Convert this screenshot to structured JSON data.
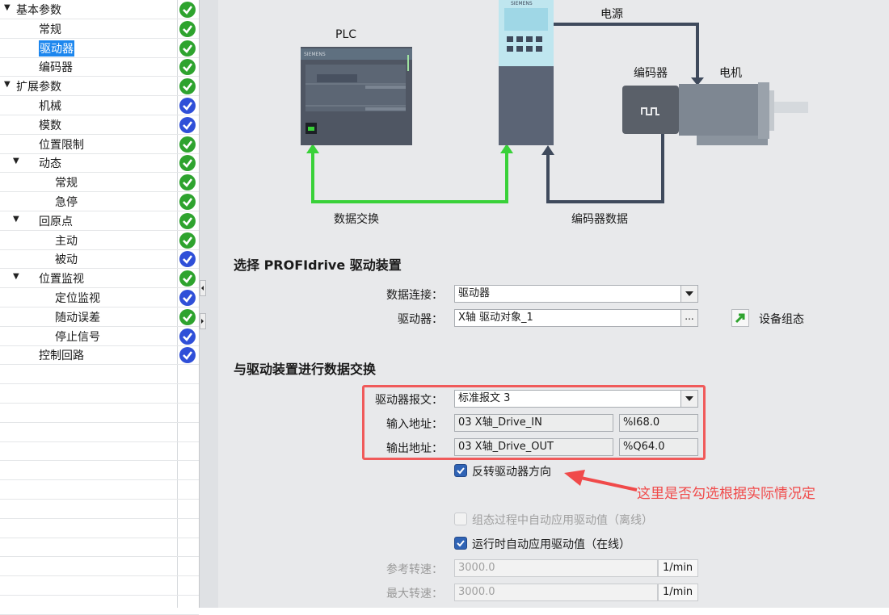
{
  "tree": {
    "items": [
      {
        "label": "基本参数",
        "arrow": true,
        "status": "green"
      },
      {
        "label": "常规",
        "status": "green"
      },
      {
        "label": "驱动器",
        "status": "green",
        "selected": true
      },
      {
        "label": "编码器",
        "status": "green"
      },
      {
        "label": "扩展参数",
        "arrow": true,
        "status": "green"
      },
      {
        "label": "机械",
        "status": "blue"
      },
      {
        "label": "模数",
        "status": "blue"
      },
      {
        "label": "位置限制",
        "status": "green"
      },
      {
        "label": "动态",
        "arrow": true,
        "status": "green"
      },
      {
        "label": "常规",
        "status": "green"
      },
      {
        "label": "急停",
        "status": "green"
      },
      {
        "label": "回原点",
        "arrow": true,
        "status": "green"
      },
      {
        "label": "主动",
        "status": "green"
      },
      {
        "label": "被动",
        "status": "blue"
      },
      {
        "label": "位置监视",
        "arrow": true,
        "status": "green"
      },
      {
        "label": "定位监视",
        "status": "blue"
      },
      {
        "label": "随动误差",
        "status": "green"
      },
      {
        "label": "停止信号",
        "status": "blue"
      },
      {
        "label": "控制回路",
        "status": "blue"
      }
    ]
  },
  "diagram": {
    "plc_label": "PLC",
    "power_label": "电源",
    "encoder_label": "编码器",
    "motor_label": "电机",
    "data_exchange_label": "数据交换",
    "encoder_data_label": "编码器数据",
    "plc_brand": "SIEMENS",
    "drive_brand": "SIEMENS"
  },
  "select_section": {
    "title": "选择 PROFIdrive 驱动装置",
    "data_connection_label": "数据连接：",
    "data_connection_value": "驱动器",
    "drive_label": "驱动器：",
    "drive_value": "X轴 驱动对象_1",
    "browse_button": "...",
    "device_config_label": "设备组态"
  },
  "exchange_section": {
    "title": "与驱动装置进行数据交换",
    "telegram_label": "驱动器报文：",
    "telegram_value": "标准报文 3",
    "input_label": "输入地址：",
    "input_name": "03 X轴_Drive_IN",
    "input_addr": "%I68.0",
    "output_label": "输出地址：",
    "output_name": "03 X轴_Drive_OUT",
    "output_addr": "%Q64.0",
    "reverse_label": "反转驱动器方向",
    "reverse_checked": true,
    "offline_auto_label": "组态过程中自动应用驱动值（离线）",
    "offline_auto_checked": false,
    "online_auto_label": "运行时自动应用驱动值（在线）",
    "online_auto_checked": true,
    "ref_speed_label": "参考转速：",
    "ref_speed_value": "3000.0",
    "ref_speed_unit": "1/min",
    "max_speed_label": "最大转速：",
    "max_speed_value": "3000.0",
    "max_speed_unit": "1/min"
  },
  "annotation": {
    "note": "这里是否勾选根据实际情况定",
    "color": "#f04a4a"
  },
  "colors": {
    "status_green": "#2ea32e",
    "status_blue": "#2f4fd8",
    "data_link": "#39d139",
    "drive_link": "#3f4a5c",
    "selected": "#1c86ee"
  }
}
